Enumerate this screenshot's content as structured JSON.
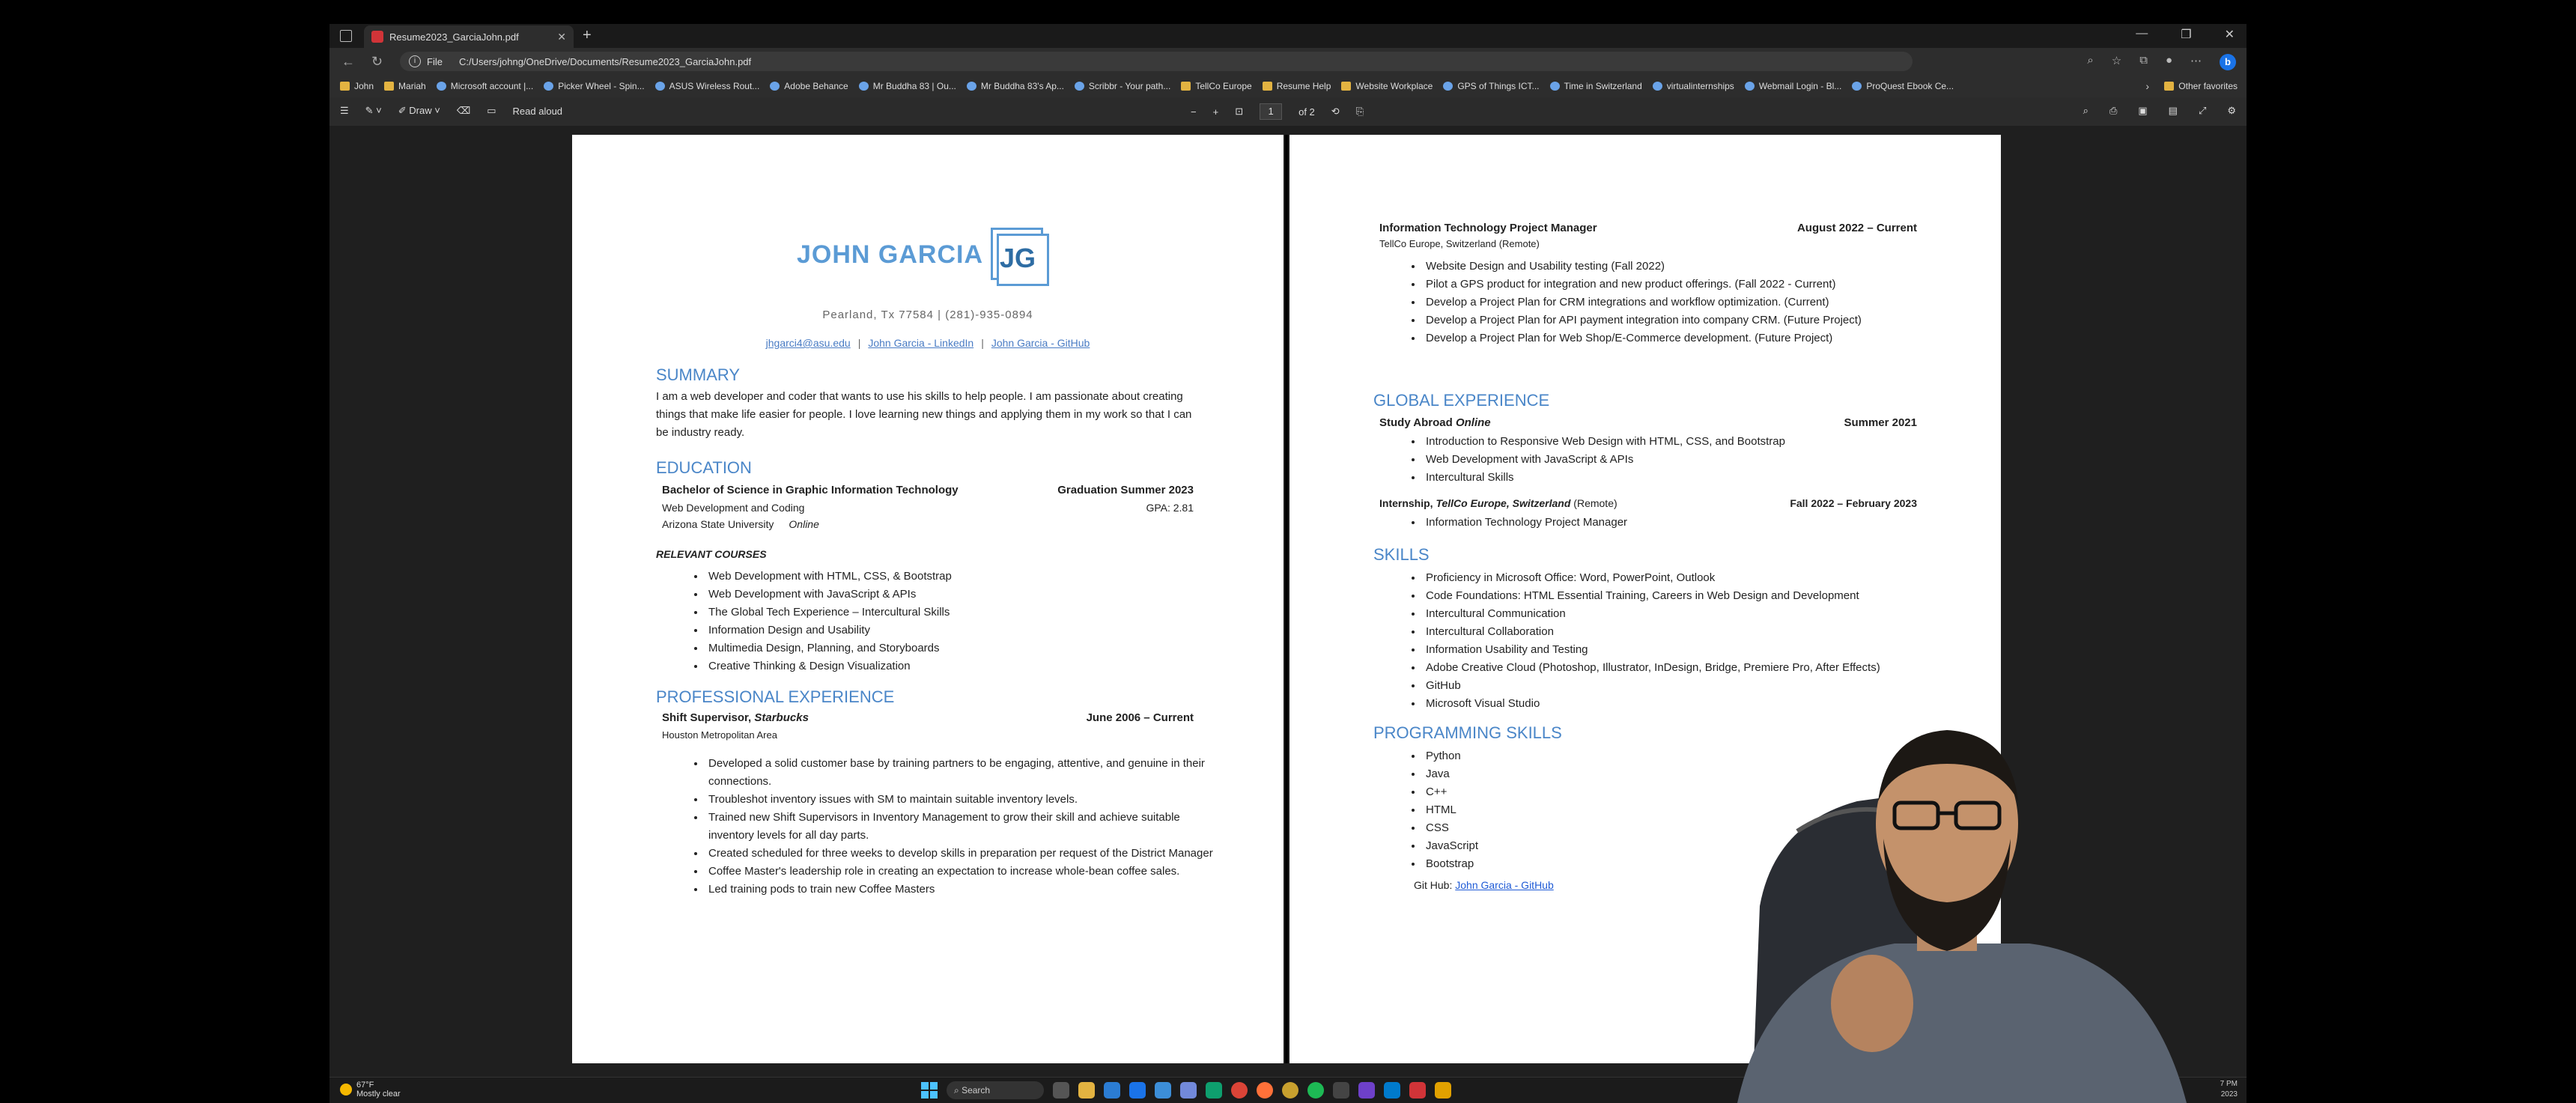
{
  "browser": {
    "tab_title": "Resume2023_GarciaJohn.pdf",
    "address_label": "File",
    "address_url": "C:/Users/johng/OneDrive/Documents/Resume2023_GarciaJohn.pdf",
    "favorites": [
      {
        "label": "John",
        "kind": "folder"
      },
      {
        "label": "Mariah",
        "kind": "folder"
      },
      {
        "label": "Microsoft account |...",
        "kind": "site"
      },
      {
        "label": "Picker Wheel - Spin...",
        "kind": "site"
      },
      {
        "label": "ASUS Wireless Rout...",
        "kind": "site"
      },
      {
        "label": "Adobe Behance",
        "kind": "site"
      },
      {
        "label": "Mr Buddha 83 | Ou...",
        "kind": "site"
      },
      {
        "label": "Mr Buddha 83's Ap...",
        "kind": "site"
      },
      {
        "label": "Scribbr - Your path...",
        "kind": "site"
      },
      {
        "label": "TellCo Europe",
        "kind": "folder"
      },
      {
        "label": "Resume Help",
        "kind": "folder"
      },
      {
        "label": "Website Workplace",
        "kind": "folder"
      },
      {
        "label": "GPS of Things ICT...",
        "kind": "site"
      },
      {
        "label": "Time in Switzerland",
        "kind": "site"
      },
      {
        "label": "virtualinternships",
        "kind": "site"
      },
      {
        "label": "Webmail Login - Bl...",
        "kind": "site"
      },
      {
        "label": "ProQuest Ebook Ce...",
        "kind": "site"
      }
    ],
    "other_favorites": "Other favorites"
  },
  "pdf_toolbar": {
    "draw_label": "Draw",
    "read_aloud_label": "Read aloud",
    "page_current": "1",
    "page_total": "of 2"
  },
  "page1": {
    "name_logo": "JOHN GARCIA",
    "logo_initials": "JG",
    "contact_line": "Pearland, Tx 77584 | (281)-935-0894",
    "links": [
      "jhgarci4@asu.edu",
      "John Garcia - LinkedIn",
      "John Garcia - GitHub"
    ],
    "summary_heading": "SUMMARY",
    "summary_text": "I am a web developer and coder that wants to use his skills to help people. I am passionate about creating things that make life easier for people. I love learning new things and applying them in my work so that I can be industry ready.",
    "education_heading": "EDUCATION",
    "degree": "Bachelor of Science in Graphic Information Technology",
    "graduation": "Graduation Summer 2023",
    "concentration": "Web Development and Coding",
    "gpa": "GPA: 2.81",
    "school": "Arizona State University",
    "school_mode": "Online",
    "courses_heading": "RELEVANT COURSES",
    "courses": [
      "Web Development with HTML, CSS, & Bootstrap",
      "Web Development with JavaScript & APIs",
      "The Global Tech Experience – Intercultural Skills",
      "Information Design and Usability",
      "Multimedia Design, Planning, and Storyboards",
      "Creative Thinking & Design Visualization"
    ],
    "professional_heading": "PROFESSIONAL EXPERIENCE",
    "job_title": "Shift Supervisor,",
    "job_company": "Starbucks",
    "job_dates": "June 2006 – Current",
    "job_location": "Houston Metropolitan Area",
    "job_bullets": [
      "Developed a solid customer base by training partners to be engaging, attentive, and genuine in their connections.",
      "Troubleshot inventory issues with SM to maintain suitable inventory levels.",
      "Trained new Shift Supervisors in Inventory Management to grow their skill and achieve suitable inventory levels for all day parts.",
      "Created scheduled for three weeks to develop skills in preparation per request of the District Manager",
      "Coffee Master's leadership role in creating an expectation to increase whole-bean coffee sales.",
      "Led training pods to train new Coffee Masters"
    ]
  },
  "page2": {
    "itpm_title": "Information Technology Project Manager",
    "itpm_dates": "August 2022 – Current",
    "itpm_location": "TellCo Europe, Switzerland (Remote)",
    "itpm_bullets": [
      "Website Design and Usability testing (Fall 2022)",
      "Pilot a GPS product for integration and new product offerings. (Fall 2022 - Current)",
      "Develop a Project Plan for CRM integrations and workflow optimization. (Current)",
      "Develop a Project Plan for API payment integration into company CRM. (Future Project)",
      "Develop a Project Plan for Web Shop/E-Commerce development. (Future Project)"
    ],
    "global_heading": "GLOBAL EXPERIENCE",
    "study_title": "Study Abroad",
    "study_mode": "Online",
    "study_dates": "Summer 2021",
    "study_bullets": [
      "Introduction to Responsive Web Design with HTML, CSS, and Bootstrap",
      "Web Development with JavaScript & APIs",
      "Intercultural Skills"
    ],
    "intern_title": "Internship,",
    "intern_company": "TellCo Europe, Switzerland",
    "intern_remote": "(Remote)",
    "intern_dates": "Fall 2022 – February 2023",
    "intern_bullets": [
      "Information Technology Project Manager"
    ],
    "skills_heading": "SKILLS",
    "skills": [
      "Proficiency in Microsoft Office: Word, PowerPoint, Outlook",
      "Code Foundations: HTML Essential Training, Careers in Web Design and Development",
      "Intercultural Communication",
      "Intercultural Collaboration",
      "Information Usability and Testing",
      "Adobe Creative Cloud (Photoshop, Illustrator, InDesign, Bridge, Premiere Pro, After Effects)",
      "GitHub",
      "Microsoft Visual Studio"
    ],
    "programming_heading": "PROGRAMMING SKILLS",
    "programming": [
      "Python",
      "Java",
      "C++",
      "HTML",
      "CSS",
      "JavaScript",
      "Bootstrap"
    ],
    "github_label": "Git Hub:",
    "github_link": "John Garcia - GitHub"
  },
  "taskbar": {
    "weather_temp": "67°F",
    "weather_desc": "Mostly clear",
    "search_label": "Search",
    "time": "7 PM",
    "date": "2023"
  },
  "colors": {
    "heading_blue": "#4a86c8",
    "link_blue": "#1f5bd6",
    "logo_blue": "#5b9bd5"
  }
}
